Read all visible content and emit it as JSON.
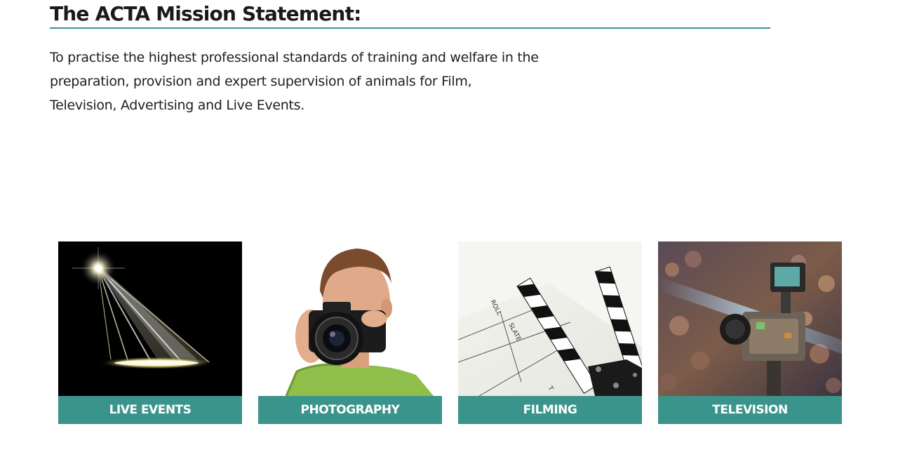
{
  "mission": {
    "title": "The ACTA Mission Statement:",
    "text": "To practise the highest professional standards of training and welfare in the preparation, provision and expert supervision of animals for Film, Television, Advertising and Live Events."
  },
  "cards": [
    {
      "label": "LIVE EVENTS",
      "image": "spotlight-image"
    },
    {
      "label": "PHOTOGRAPHY",
      "image": "photographer-image"
    },
    {
      "label": "FILMING",
      "image": "clapperboard-image"
    },
    {
      "label": "TELEVISION",
      "image": "tv-camera-image"
    }
  ],
  "clapperboard": {
    "roll_text": "ROLL",
    "slate_text": "SLATE",
    "take_text": "T"
  },
  "colors": {
    "accent": "#3a948b",
    "rule": "#3c9189"
  }
}
